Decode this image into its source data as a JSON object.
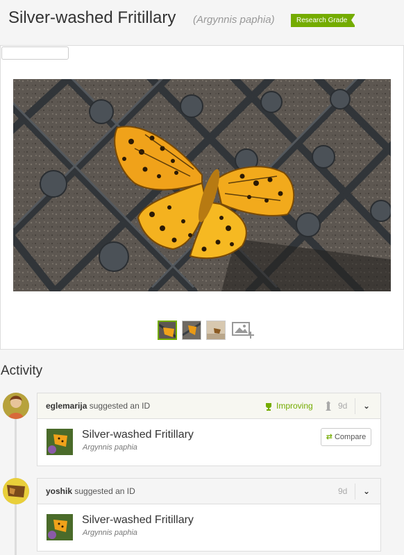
{
  "observation": {
    "common_name": "Silver-washed Fritillary",
    "scientific_name": "(Argynnis paphia)",
    "quality_grade": "Research Grade"
  },
  "photo": {
    "license_icon": "cc",
    "info_icon": "i",
    "thumbnail_count": 3,
    "selected_thumbnail": 1
  },
  "activity": {
    "title": "Activity",
    "items": [
      {
        "user": "eglemarija",
        "action": "suggested an ID",
        "status": "Improving",
        "age": "9d",
        "taxon_name": "Silver-washed Fritillary",
        "taxon_sci": "Argynnis paphia",
        "compare_label": "Compare"
      },
      {
        "user": "yoshik",
        "action": "suggested an ID",
        "age": "9d",
        "taxon_name": "Silver-washed Fritillary",
        "taxon_sci": "Argynnis paphia"
      }
    ]
  },
  "colors": {
    "accent": "#74ac00",
    "wing_orange": "#f0a21a"
  }
}
